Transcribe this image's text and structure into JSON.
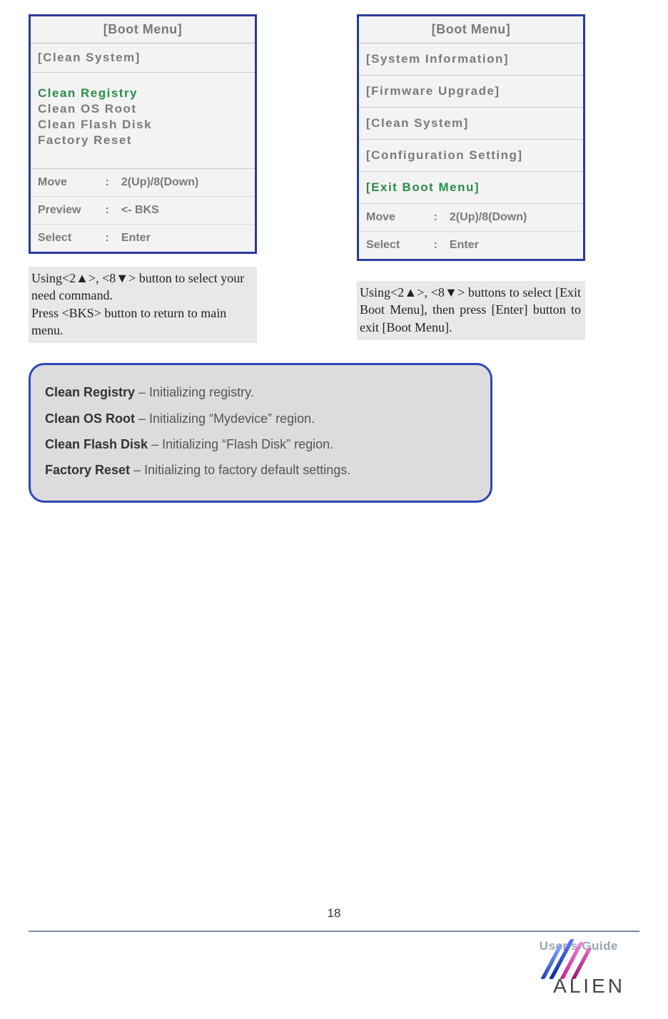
{
  "left_menu": {
    "title": "[Boot Menu]",
    "section": "[Clean System]",
    "items": [
      {
        "label": "Clean Registry",
        "selected": true
      },
      {
        "label": "Clean OS Root",
        "selected": false
      },
      {
        "label": "Clean Flash Disk",
        "selected": false
      },
      {
        "label": "Factory Reset",
        "selected": false
      }
    ],
    "hints": [
      {
        "label": "Move",
        "value": "2(Up)/8(Down)"
      },
      {
        "label": "Preview",
        "value": "<- BKS"
      },
      {
        "label": "Select",
        "value": "Enter"
      }
    ]
  },
  "right_menu": {
    "title": "[Boot Menu]",
    "items": [
      {
        "label": "[System Information]",
        "selected": false
      },
      {
        "label": "[Firmware Upgrade]",
        "selected": false
      },
      {
        "label": "[Clean System]",
        "selected": false
      },
      {
        "label": "[Configuration Setting]",
        "selected": false
      },
      {
        "label": "[Exit Boot Menu]",
        "selected": true
      }
    ],
    "hints": [
      {
        "label": "Move",
        "value": "2(Up)/8(Down)"
      },
      {
        "label": "Select",
        "value": "Enter"
      }
    ]
  },
  "instruction_left": "Using<2▲>, <8▼> button to select your need command.\nPress <BKS> button to return to main menu.",
  "instruction_right": "Using<2▲>, <8▼> buttons to select [Exit Boot Menu], then press [Enter] button to exit [Boot Menu].",
  "descriptions": [
    {
      "term": "Clean Registry",
      "text": " – Initializing registry."
    },
    {
      "term": "Clean OS Root",
      "text": " – Initializing “Mydevice” region."
    },
    {
      "term": "Clean Flash Disk",
      "text": " – Initializing “Flash Disk” region."
    },
    {
      "term": "Factory Reset",
      "text": " – Initializing to factory default settings."
    }
  ],
  "page_number": "18",
  "footer_label": "User's Guide",
  "brand": "ALIEN"
}
